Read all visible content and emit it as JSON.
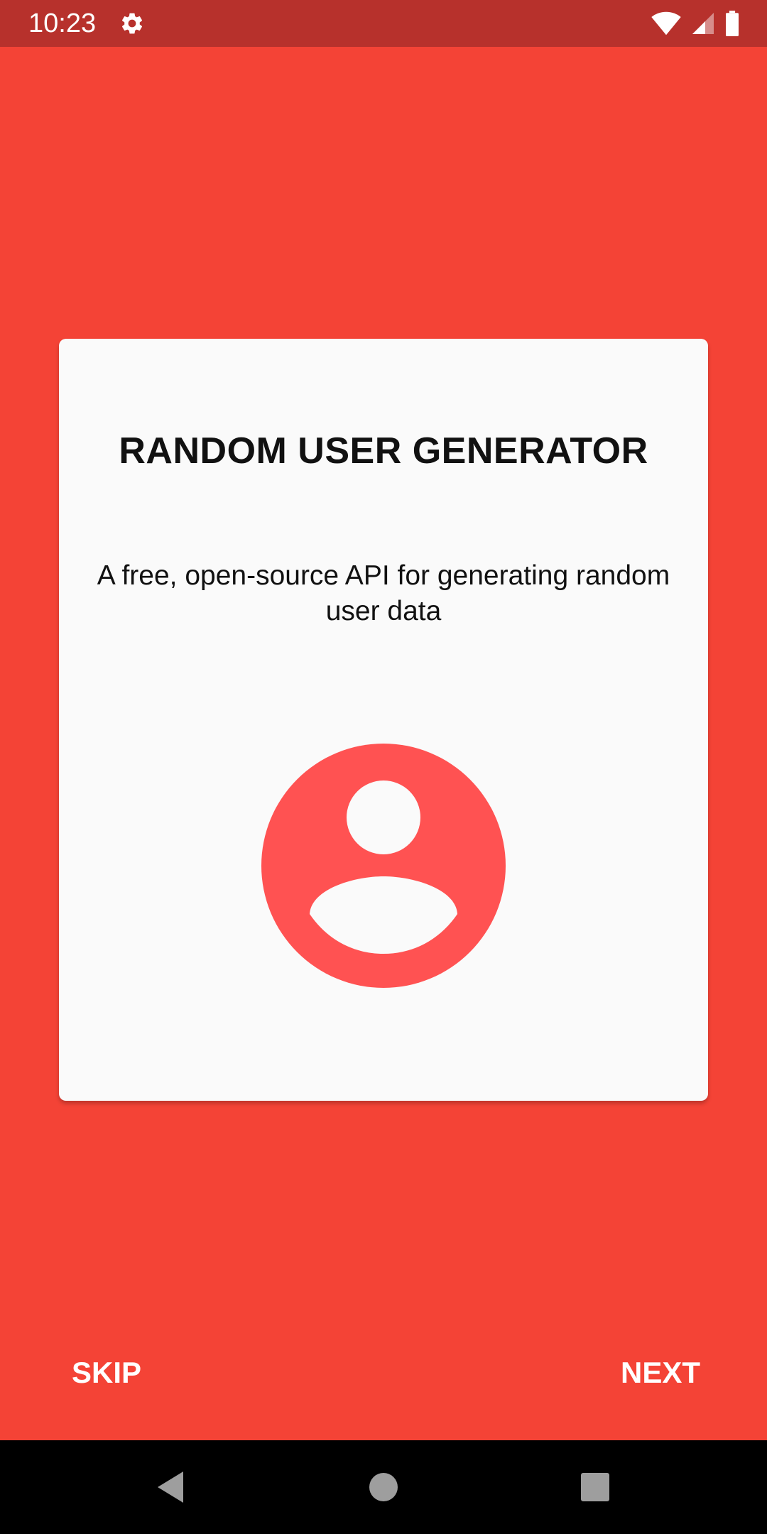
{
  "status_bar": {
    "time": "10:23",
    "icons": [
      "settings-gear-icon",
      "wifi-icon",
      "cellular-signal-icon",
      "battery-icon"
    ]
  },
  "colors": {
    "background": "#f44336",
    "status_bar": "#b7312c",
    "card": "#fafafa",
    "avatar": "#ff5252",
    "nav_bar": "#000000"
  },
  "card": {
    "title": "RANDOM USER GENERATOR",
    "subtitle": "A free, open-source API for generating random user data",
    "icon": "account-circle-icon"
  },
  "actions": {
    "skip_label": "SKIP",
    "next_label": "NEXT"
  },
  "nav_bar": {
    "icons": [
      "back-icon",
      "home-icon",
      "recents-icon"
    ]
  }
}
